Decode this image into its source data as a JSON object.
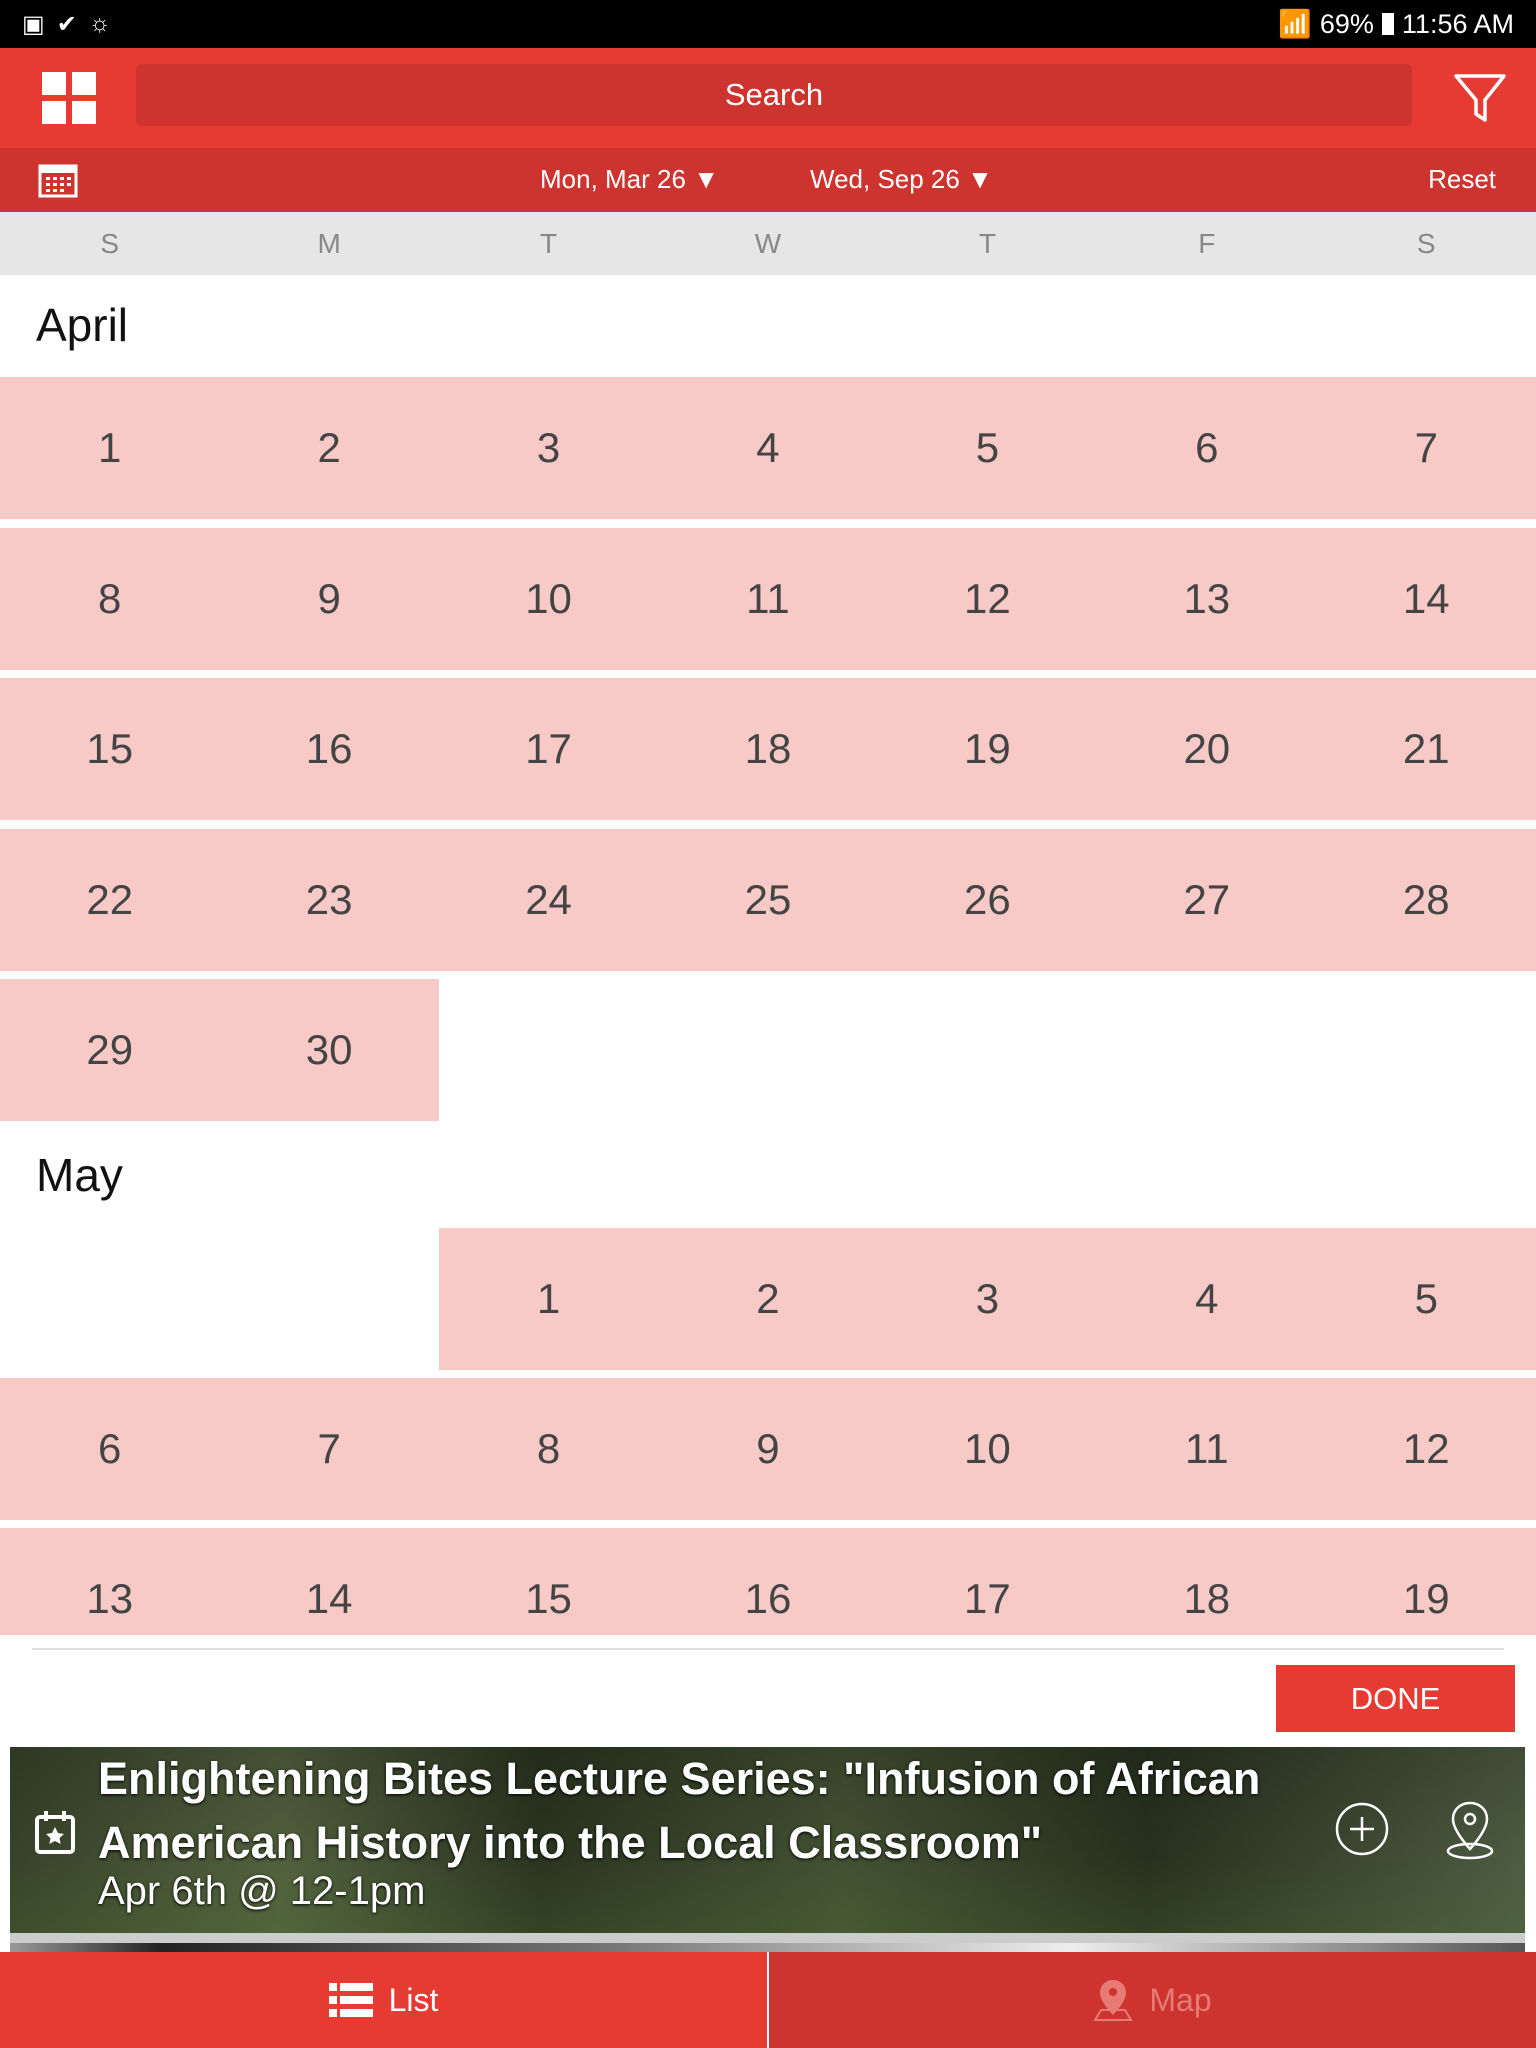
{
  "status_bar": {
    "battery": "69%",
    "time": "11:56 AM"
  },
  "header": {
    "search_placeholder": "Search"
  },
  "date_bar": {
    "start_date": "Mon, Mar 26",
    "end_date": "Wed, Sep 26",
    "reset_label": "Reset"
  },
  "weekdays": [
    "S",
    "M",
    "T",
    "W",
    "T",
    "F",
    "S"
  ],
  "calendar": {
    "april": {
      "label": "April",
      "rows": [
        [
          "1",
          "2",
          "3",
          "4",
          "5",
          "6",
          "7"
        ],
        [
          "8",
          "9",
          "10",
          "11",
          "12",
          "13",
          "14"
        ],
        [
          "15",
          "16",
          "17",
          "18",
          "19",
          "20",
          "21"
        ],
        [
          "22",
          "23",
          "24",
          "25",
          "26",
          "27",
          "28"
        ],
        [
          "29",
          "30",
          "",
          "",
          "",
          "",
          ""
        ]
      ]
    },
    "may": {
      "label": "May",
      "rows": [
        [
          "",
          "",
          "1",
          "2",
          "3",
          "4",
          "5"
        ],
        [
          "6",
          "7",
          "8",
          "9",
          "10",
          "11",
          "12"
        ],
        [
          "13",
          "14",
          "15",
          "16",
          "17",
          "18",
          "19"
        ]
      ]
    }
  },
  "done_label": "DONE",
  "event": {
    "title": "Enlightening Bites Lecture Series: \"Infusion of African American History into the Local Classroom\"",
    "when": "Apr 6th @ 12-1pm"
  },
  "bottom_nav": {
    "list_label": "List",
    "map_label": "Map"
  },
  "colors": {
    "primary": "#e53b33",
    "primary_dark": "#cd3430",
    "range_highlight": "#f7c9c7"
  }
}
